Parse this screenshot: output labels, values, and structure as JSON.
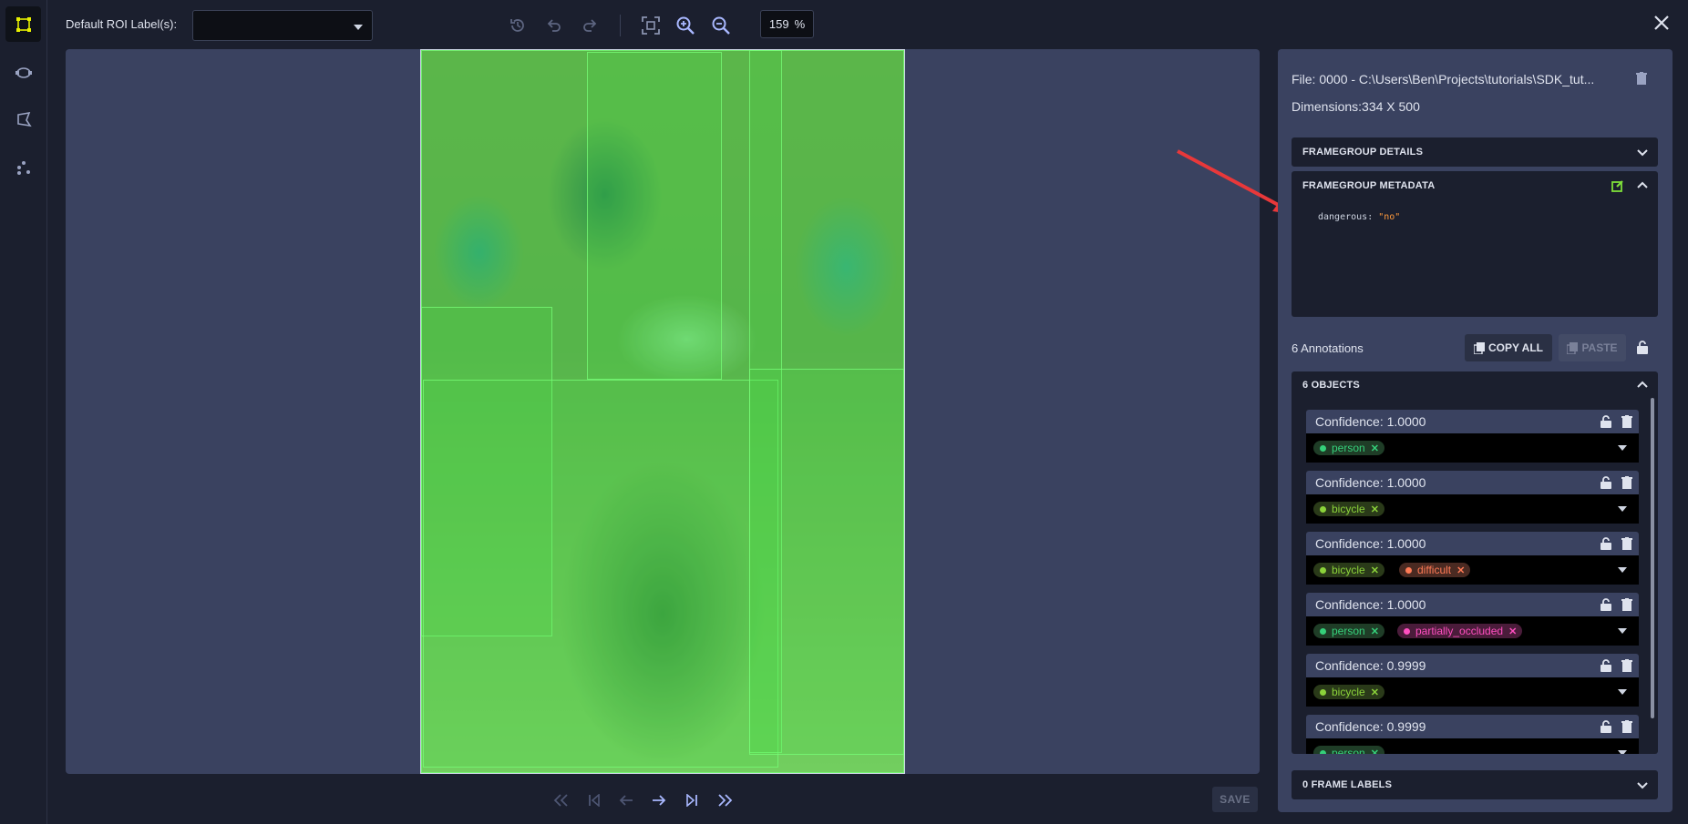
{
  "toolbar": {
    "roi_label": "Default ROI Label(s):",
    "roi_select_value": "",
    "zoom_value": "159",
    "zoom_unit": "%"
  },
  "rail": {
    "tools": [
      "rectangle-tool-icon",
      "ellipse-tool-icon",
      "polygon-tool-icon",
      "keypoints-tool-icon"
    ],
    "active": "rectangle-tool-icon"
  },
  "file": {
    "file_label": "File:",
    "file_value": "0000 -  C:\\Users\\Ben\\Projects\\tutorials\\SDK_tut...",
    "dimensions_label": "Dimensions:",
    "dimensions_value": "334 X 500"
  },
  "sections": {
    "framegroup_details": "FRAMEGROUP DETAILS",
    "framegroup_metadata": "FRAMEGROUP METADATA",
    "metadata_key": "dangerous",
    "metadata_value": "\"no\"",
    "objects_title": "6 OBJECTS",
    "frame_labels": "0 FRAME LABELS"
  },
  "annotations": {
    "count_label": "6 Annotations",
    "copy_all": "COPY ALL",
    "paste": "PASTE"
  },
  "objects": [
    {
      "confidence": "Confidence: 1.0000",
      "tags": [
        {
          "label": "person",
          "color": "green"
        }
      ]
    },
    {
      "confidence": "Confidence: 1.0000",
      "tags": [
        {
          "label": "bicycle",
          "color": "lime"
        }
      ]
    },
    {
      "confidence": "Confidence: 1.0000",
      "tags": [
        {
          "label": "bicycle",
          "color": "lime"
        },
        {
          "label": "difficult",
          "color": "orange"
        }
      ]
    },
    {
      "confidence": "Confidence: 1.0000",
      "tags": [
        {
          "label": "person",
          "color": "green"
        },
        {
          "label": "partially_occluded",
          "color": "pink"
        }
      ]
    },
    {
      "confidence": "Confidence: 0.9999",
      "tags": [
        {
          "label": "bicycle",
          "color": "lime"
        }
      ]
    },
    {
      "confidence": "Confidence: 0.9999",
      "tags": [
        {
          "label": "person",
          "color": "green"
        }
      ]
    }
  ],
  "bottom": {
    "save": "SAVE"
  },
  "colors": {
    "accent_yellow": "#e8f000",
    "edit_green": "#7ee03a",
    "arrow_red": "#e8383a"
  }
}
